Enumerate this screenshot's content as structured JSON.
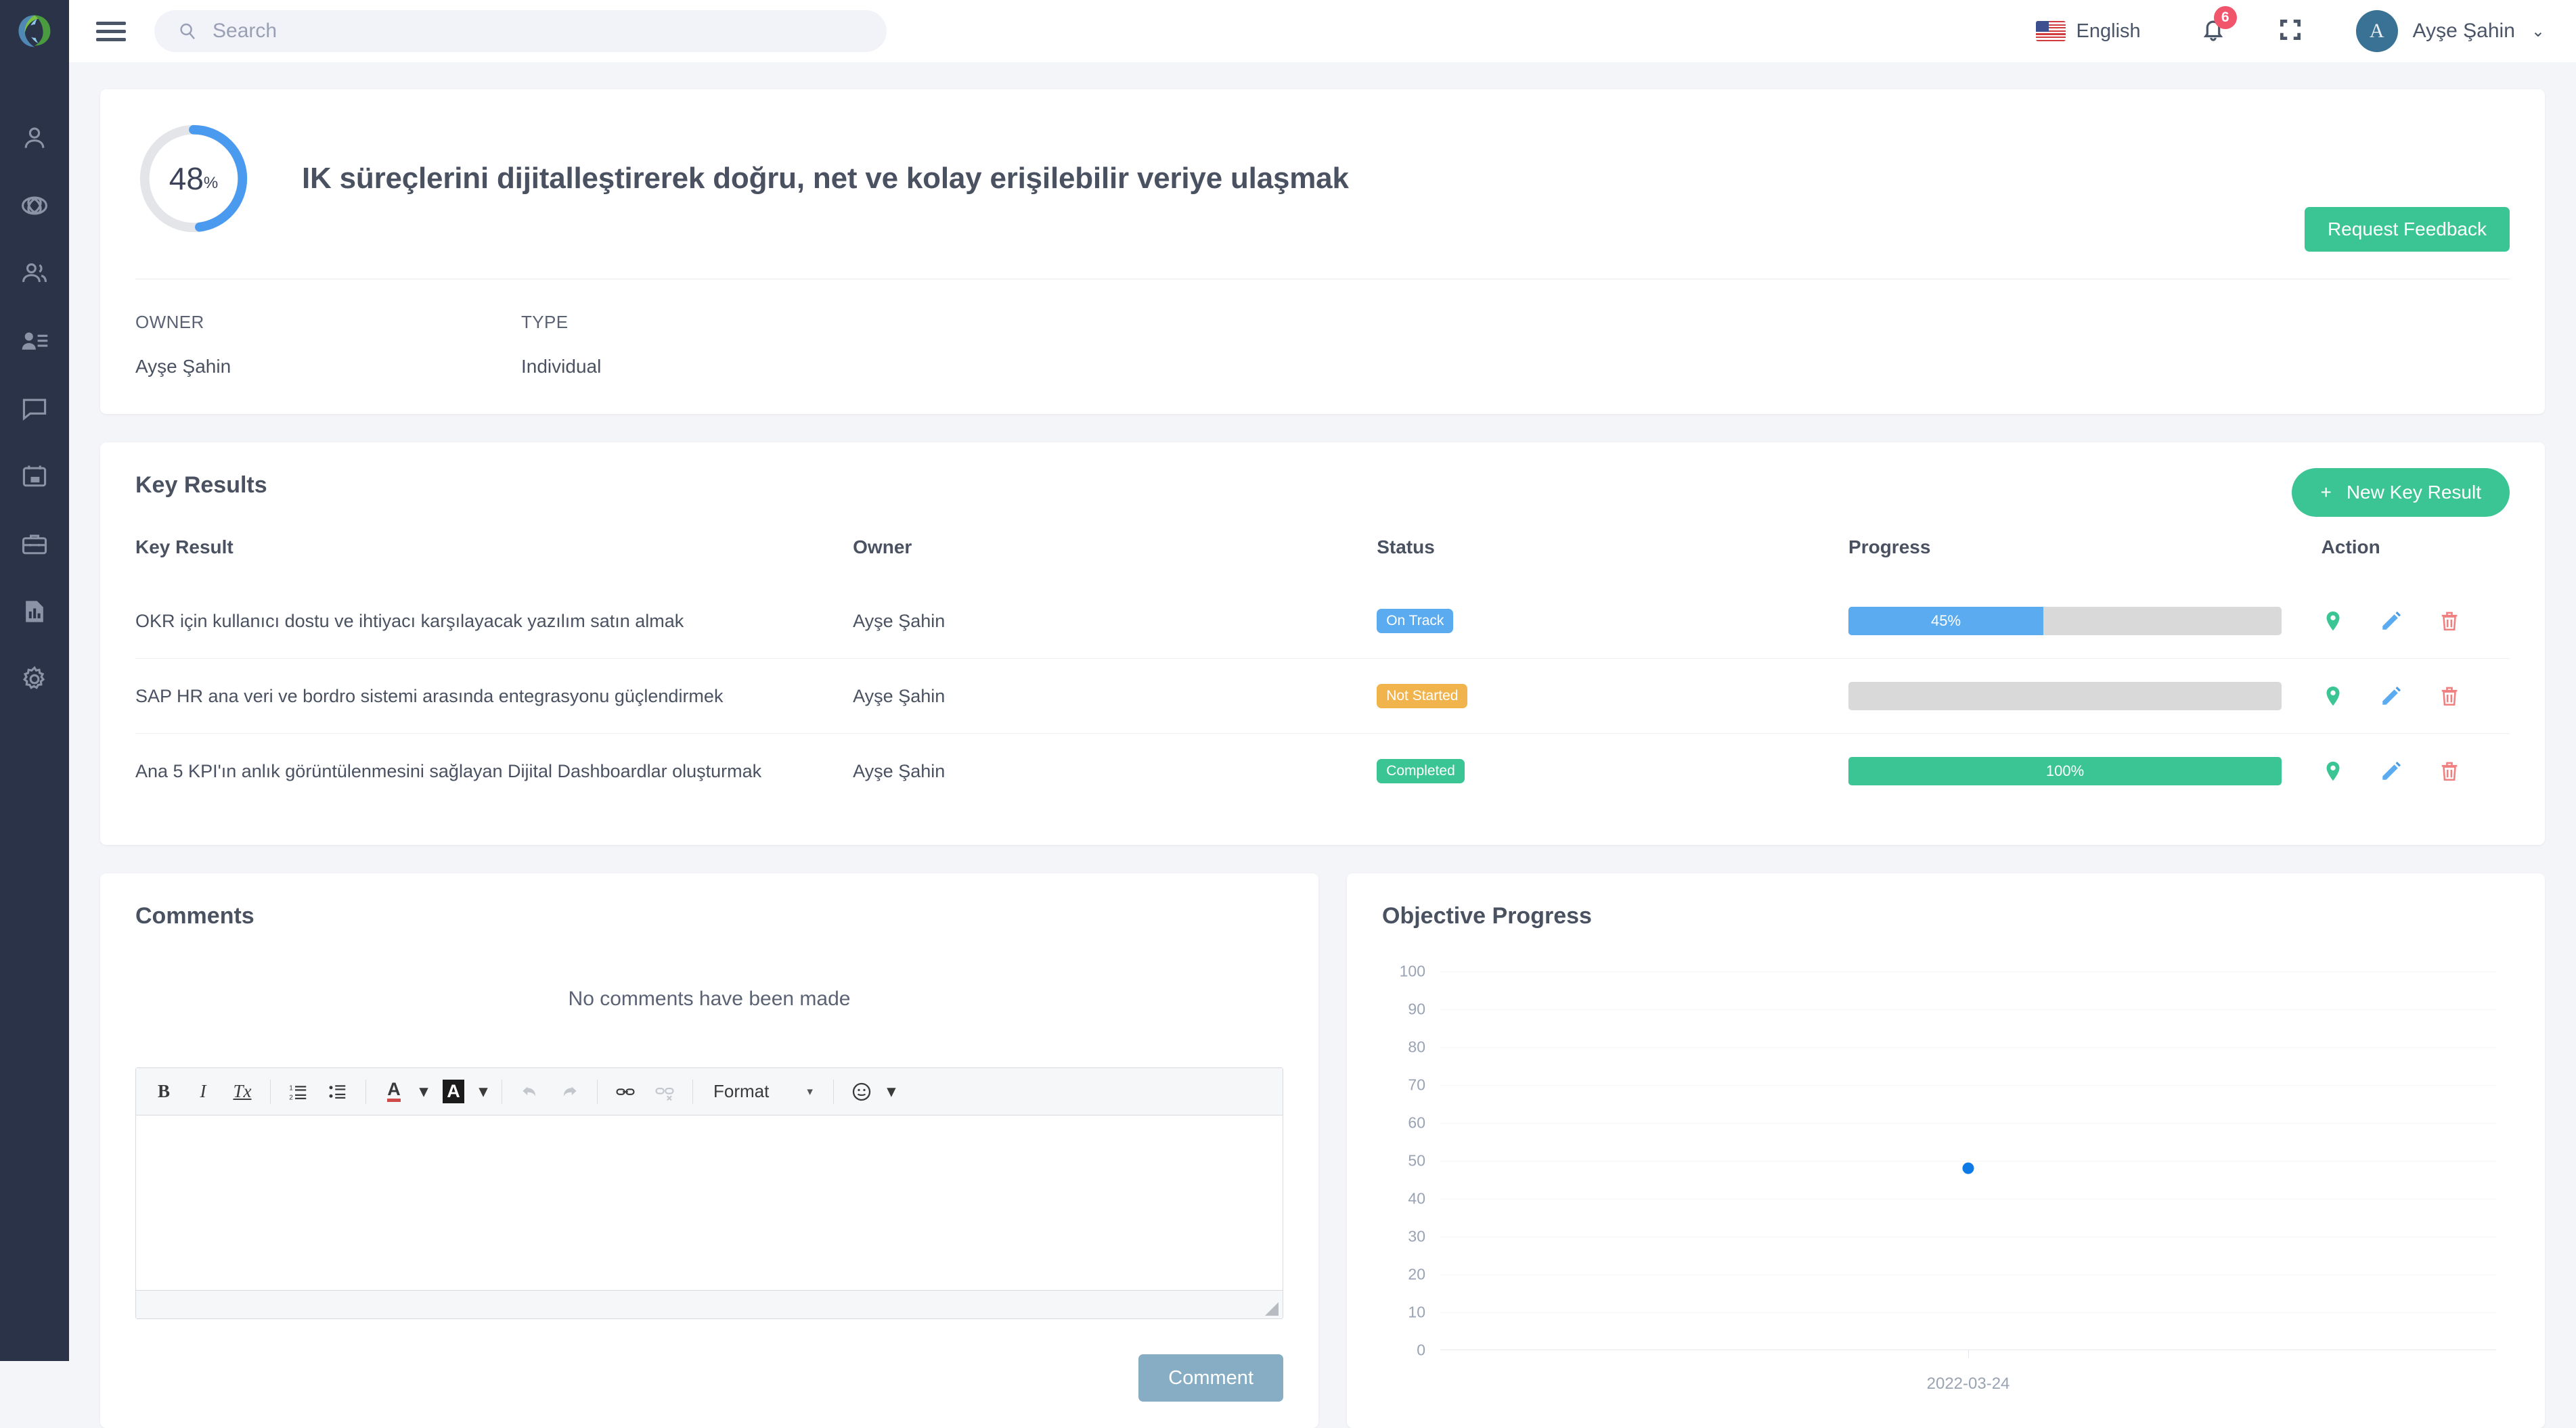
{
  "sidebar": {
    "logo_name": "app-logo",
    "items": [
      {
        "name": "sidebar-item-profile",
        "icon": "person-icon"
      },
      {
        "name": "sidebar-item-objectives",
        "icon": "target-icon"
      },
      {
        "name": "sidebar-item-teams",
        "icon": "people-icon"
      },
      {
        "name": "sidebar-item-directory",
        "icon": "user-list-icon"
      },
      {
        "name": "sidebar-item-messages",
        "icon": "chat-icon"
      },
      {
        "name": "sidebar-item-calendar",
        "icon": "calendar-icon"
      },
      {
        "name": "sidebar-item-jobs",
        "icon": "briefcase-icon"
      },
      {
        "name": "sidebar-item-reports",
        "icon": "report-icon"
      },
      {
        "name": "sidebar-item-settings",
        "icon": "gear-icon"
      }
    ]
  },
  "topbar": {
    "search_placeholder": "Search",
    "search_value": "",
    "language": "English",
    "notification_count": "6",
    "user_name": "Ayşe Şahin",
    "user_initial": "A",
    "caret": "⌄"
  },
  "objective": {
    "progress_percent": "48",
    "percent_symbol": "%",
    "title": "IK süreçlerini dijitalleştirerek doğru, net ve kolay erişilebilir veriye ulaşmak",
    "request_feedback_label": "Request Feedback",
    "owner_label": "OWNER",
    "owner_value": "Ayşe Şahin",
    "type_label": "TYPE",
    "type_value": "Individual",
    "donut_color": "#4a9bf0",
    "donut_track": "#e3e5e8"
  },
  "key_results": {
    "section_title": "Key Results",
    "new_button_label": "New Key Result",
    "new_button_icon": "plus-icon",
    "columns": [
      "Key Result",
      "Owner",
      "Status",
      "Progress",
      "Action"
    ],
    "rows": [
      {
        "key_result": "OKR için kullanıcı dostu ve ihtiyacı karşılayacak yazılım satın almak",
        "owner": "Ayşe Şahin",
        "status": "On Track",
        "status_color": "#5aabf0",
        "progress_label": "45%",
        "progress_value": 45,
        "progress_color": "#5aabf0"
      },
      {
        "key_result": "SAP HR ana veri ve bordro sistemi arasında entegrasyonu güçlendirmek",
        "owner": "Ayşe Şahin",
        "status": "Not Started",
        "status_color": "#f1b44c",
        "progress_label": "",
        "progress_value": 0,
        "progress_color": "#d9d9d9"
      },
      {
        "key_result": "Ana 5 KPI'ın anlık görüntülenmesini sağlayan Dijital Dashboardlar oluşturmak",
        "owner": "Ayşe Şahin",
        "status": "Completed",
        "status_color": "#3bc594",
        "progress_label": "100%",
        "progress_value": 100,
        "progress_color": "#3bc594"
      }
    ],
    "action_icons": [
      "location-pin-icon",
      "edit-pencil-icon",
      "delete-trash-icon"
    ]
  },
  "comments": {
    "section_title": "Comments",
    "empty_message": "No comments have been made",
    "submit_label": "Comment",
    "editor": {
      "bold": "B",
      "italic": "I",
      "remove_format": "Tx",
      "numbered_list": "numbered-list-icon",
      "bullet_list": "bullet-list-icon",
      "text_color": "A",
      "background_color": "A",
      "undo": "undo-icon",
      "redo": "redo-icon",
      "link": "link-icon",
      "unlink": "unlink-icon",
      "format_label": "Format",
      "emoji": "emoji-icon",
      "caret": "▾",
      "content": ""
    }
  },
  "chart_data": {
    "type": "scatter",
    "title": "Objective Progress",
    "xlabel": "",
    "ylabel": "",
    "x": [
      "2022-03-24"
    ],
    "values": [
      48
    ],
    "categories": [
      "2022-03-24"
    ],
    "yticks": [
      100,
      90,
      80,
      70,
      60,
      50,
      40,
      30,
      20,
      10,
      0
    ],
    "ylim": [
      0,
      100
    ],
    "grid": true,
    "legend": false,
    "point_color": "#0d7ae5",
    "series": [
      {
        "name": "Objective Progress",
        "values": [
          48
        ]
      }
    ]
  }
}
